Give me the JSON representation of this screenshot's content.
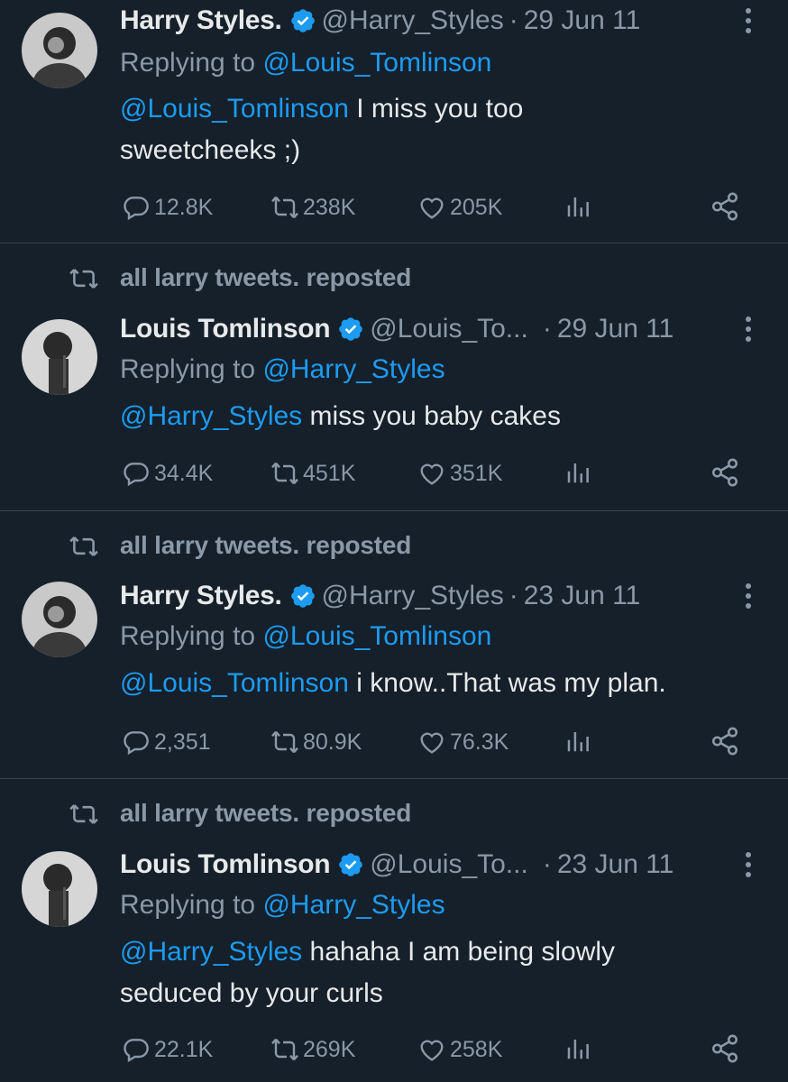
{
  "colors": {
    "background": "#15202b",
    "text": "#e7e9ea",
    "muted": "#8b98a5",
    "link": "#1d9bf0",
    "divider": "#38444d"
  },
  "tweets": [
    {
      "author": "Harry Styles.",
      "handle": "@Harry_Styles",
      "date": "29 Jun 11",
      "replying_prefix": "Replying to ",
      "replying_to": "@Louis_Tomlinson",
      "mention": "@Louis_Tomlinson",
      "text_line1": " I miss you too",
      "text_line2": "sweetcheeks ;)",
      "replies": "12.8K",
      "reposts": "238K",
      "likes": "205K"
    },
    {
      "repost_label": "all larry tweets. reposted",
      "author": "Louis Tomlinson",
      "handle": "@Louis_To...",
      "date": "29 Jun 11",
      "replying_prefix": "Replying to ",
      "replying_to": "@Harry_Styles",
      "mention": "@Harry_Styles",
      "text_line1": " miss you baby cakes",
      "text_line2": "",
      "replies": "34.4K",
      "reposts": "451K",
      "likes": "351K"
    },
    {
      "repost_label": "all larry tweets. reposted",
      "author": "Harry Styles.",
      "handle": "@Harry_Styles",
      "date": "23 Jun 11",
      "replying_prefix": "Replying to ",
      "replying_to": "@Louis_Tomlinson",
      "mention": "@Louis_Tomlinson",
      "text_line1": " i know..That was my plan.",
      "text_line2": "",
      "replies": "2,351",
      "reposts": "80.9K",
      "likes": "76.3K"
    },
    {
      "repost_label": "all larry tweets. reposted",
      "author": "Louis Tomlinson",
      "handle": "@Louis_To...",
      "date": "23 Jun 11",
      "replying_prefix": "Replying to ",
      "replying_to": "@Harry_Styles",
      "mention": "@Harry_Styles",
      "text_line1": " hahaha I am being slowly",
      "text_line2": "seduced by your curls",
      "replies": "22.1K",
      "reposts": "269K",
      "likes": "258K"
    }
  ],
  "separator": "·"
}
